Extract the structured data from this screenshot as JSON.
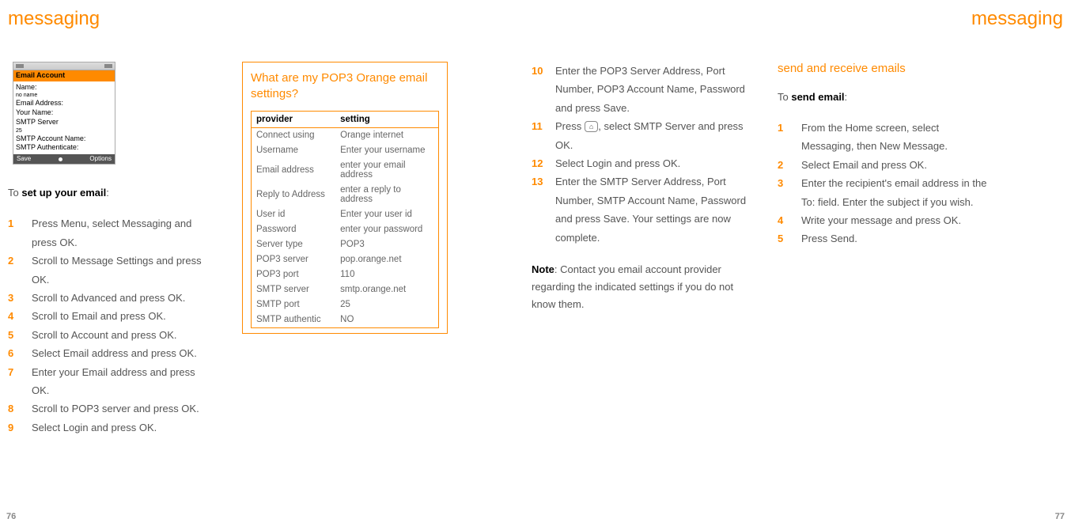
{
  "header": {
    "title_left": "messaging",
    "title_right": "messaging"
  },
  "phone": {
    "title": "Email Account",
    "rows": [
      "Name:",
      "no name",
      "Email Address:",
      "Your Name:",
      "SMTP Server",
      "25",
      "SMTP Account Name:",
      "SMTP Authenticate:"
    ],
    "softkey_left": "Save",
    "softkey_right": "Options"
  },
  "col1": {
    "lead_prefix": "To ",
    "lead_bold": "set up your email",
    "lead_suffix": ":",
    "steps": [
      "Press Menu, select Messaging and press OK.",
      "Scroll to Message Settings and press OK.",
      "Scroll to Advanced and press OK.",
      "Scroll to Email and press OK.",
      "Scroll to Account and press OK.",
      "Select Email address and press OK.",
      "Enter your Email address and press OK.",
      "Scroll to POP3 server and press OK.",
      "Select Login and press OK."
    ]
  },
  "orange_box": {
    "title": "What are my POP3 Orange email settings?",
    "th1": "provider",
    "th2": "setting",
    "rows": [
      [
        "Connect using",
        "Orange internet"
      ],
      [
        "Username",
        "Enter your username"
      ],
      [
        "Email address",
        "enter your email address"
      ],
      [
        "Reply to Address",
        "enter a reply to address"
      ],
      [
        "User id",
        "Enter your user id"
      ],
      [
        "Password",
        "enter your password"
      ],
      [
        "Server type",
        "POP3"
      ],
      [
        "POP3 server",
        "pop.orange.net"
      ],
      [
        "POP3 port",
        "110"
      ],
      [
        "SMTP server",
        "smtp.orange.net"
      ],
      [
        "SMTP port",
        "25"
      ],
      [
        "SMTP authentic",
        "NO"
      ]
    ]
  },
  "col3": {
    "steps": [
      {
        "n": "10",
        "t": "Enter the POP3 Server Address, Port Number, POP3 Account Name, Password and press Save."
      },
      {
        "n": "11",
        "pre": "Press ",
        "post": ", select SMTP Server and press OK."
      },
      {
        "n": "12",
        "t": "Select Login and press OK."
      },
      {
        "n": "13",
        "t": "Enter the SMTP Server Address, Port Number, SMTP Account Name, Password and press Save. Your settings are now complete."
      }
    ],
    "note_label": "Note",
    "note_text": ": Contact you email account provider regarding the indicated settings if you do not know them."
  },
  "col4": {
    "heading": "send and receive emails",
    "lead_prefix": "To ",
    "lead_bold": "send email",
    "lead_suffix": ":",
    "steps": [
      "From the Home screen, select Messaging, then New Message.",
      "Select Email and press OK.",
      "Enter the recipient's email address in the To: field. Enter the subject if you wish.",
      "Write your message and press OK.",
      "Press Send."
    ]
  },
  "page_left": "76",
  "page_right": "77"
}
